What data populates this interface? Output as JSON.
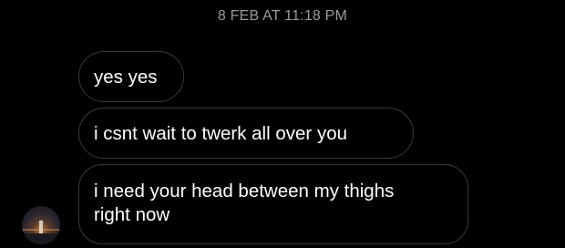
{
  "conversation": {
    "timestamp": "8 FEB AT 11:18 PM",
    "messages": [
      {
        "text": "yes yes"
      },
      {
        "text": "i csnt wait to twerk all over you"
      },
      {
        "text_line1": "i need your head between my thighs",
        "text_line2": "right now"
      }
    ]
  },
  "colors": {
    "background": "#000000",
    "bubble_border": "#3a3a3c",
    "timestamp": "#9a9aa0",
    "text": "#ffffff"
  },
  "icons": {
    "avatar": "sender-avatar-sunset-silhouette"
  }
}
